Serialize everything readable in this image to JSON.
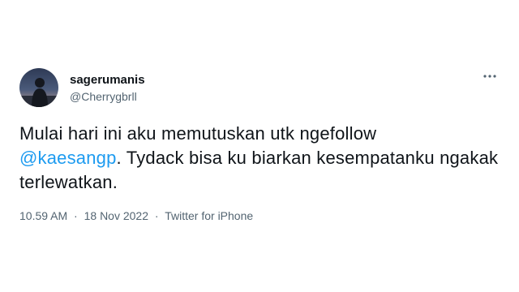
{
  "author": {
    "display_name": "sagerumanis",
    "handle": "@Cherrygbrll"
  },
  "menu": {
    "icon": "more-horizontal-icon"
  },
  "tweet": {
    "text_part1": "Mulai hari ini aku memutuskan utk ngefollow",
    "mention": "@kaesangp",
    "text_part2": ". Tydack bisa ku biarkan kesempatanku ngakak terlewatkan."
  },
  "meta": {
    "time": "10.59 AM",
    "separator1": "·",
    "date": "18 Nov 2022",
    "separator2": "·",
    "source": "Twitter for iPhone"
  },
  "colors": {
    "text": "#0f1419",
    "secondary": "#536471",
    "link": "#1d9bf0"
  }
}
